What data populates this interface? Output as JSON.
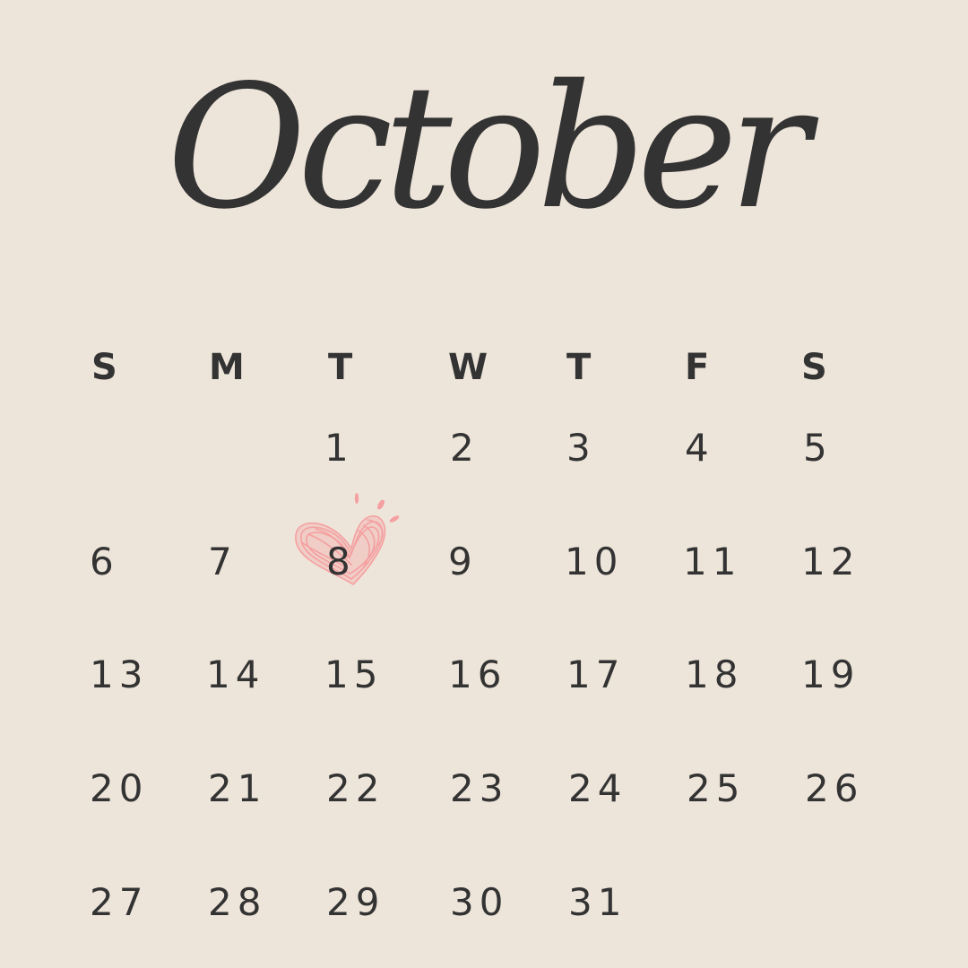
{
  "calendar": {
    "month": "October",
    "weekdays": [
      "S",
      "M",
      "T",
      "W",
      "T",
      "F",
      "S"
    ],
    "days": [
      "1",
      "2",
      "3",
      "4",
      "5",
      "6",
      "7",
      "8",
      "9",
      "10",
      "11",
      "12",
      "13",
      "14",
      "15",
      "16",
      "17",
      "18",
      "19",
      "20",
      "21",
      "22",
      "23",
      "24",
      "25",
      "26",
      "27",
      "28",
      "29",
      "30",
      "31"
    ],
    "highlighted_day": "8",
    "highlight_icon": "heart-icon",
    "colors": {
      "background": "#EEE5DA",
      "text": "#333333",
      "heart": "#F4A0A0"
    }
  }
}
